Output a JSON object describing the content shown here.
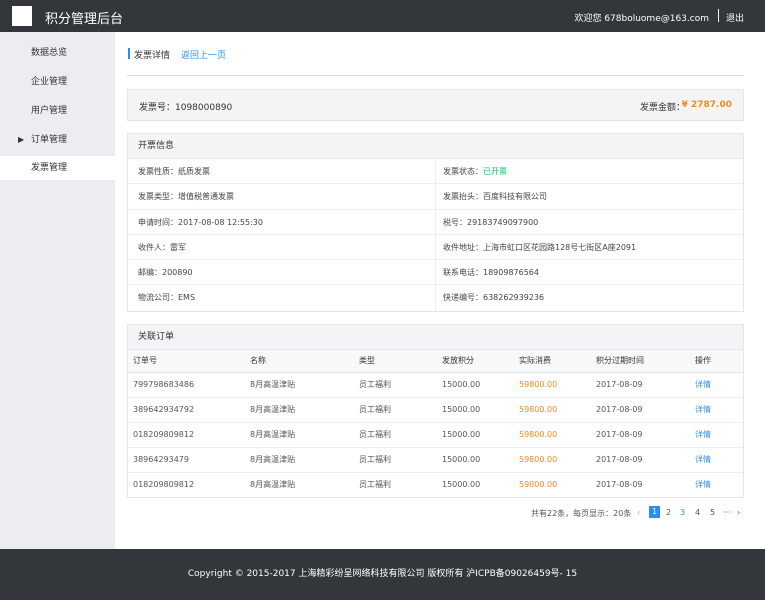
{
  "header": {
    "title": "积分管理后台",
    "welcome": "欢迎您 678boluome@163.com",
    "logout": "退出"
  },
  "sidebar": {
    "items": [
      {
        "label": "数据总览"
      },
      {
        "label": "企业管理"
      },
      {
        "label": "用户管理"
      },
      {
        "label": "订单管理"
      },
      {
        "label": "发票管理"
      }
    ]
  },
  "breadcrumb": {
    "title": "发票详情",
    "back": "返回上一页"
  },
  "invoice": {
    "number": "发票号：1098000890",
    "amount_label": "发票金额：",
    "amount": "¥ 2787.00"
  },
  "info_panel": {
    "title": "开票信息",
    "rows": [
      {
        "left": "发票性质：纸质发票",
        "right_label": "发票状态：",
        "right_value": "已开票"
      },
      {
        "left": "发票类型：增值税普通发票",
        "right_label": "发票抬头：百度科技有限公司",
        "right_value": ""
      },
      {
        "left": "申请时间：2017-08-08  12:55:30",
        "right_label": "税号：29183749097900",
        "right_value": ""
      },
      {
        "left": "收件人：雷军",
        "right_label": "收件地址：上海市虹口区花园路128号七街区A座2091",
        "right_value": ""
      },
      {
        "left": "邮编：200890",
        "right_label": "联系电话：18909876564",
        "right_value": ""
      },
      {
        "left": "物流公司：EMS",
        "right_label": "快递编号：638262939236",
        "right_value": ""
      }
    ]
  },
  "orders_panel": {
    "title": "关联订单",
    "columns": [
      "订单号",
      "名称",
      "类型",
      "发放积分",
      "实际消费",
      "积分过期时间",
      "操作"
    ],
    "rows": [
      [
        "799798683486",
        "8月高温津贴",
        "员工福利",
        "15000.00",
        "59800.00",
        "2017-08-09",
        "详情"
      ],
      [
        "389642934792",
        "8月高温津贴",
        "员工福利",
        "15000.00",
        "59800.00",
        "2017-08-09",
        "详情"
      ],
      [
        "018209809812",
        "8月高温津贴",
        "员工福利",
        "15000.00",
        "59800.00",
        "2017-08-09",
        "详情"
      ],
      [
        "38964293479",
        "8月高温津贴",
        "员工福利",
        "15000.00",
        "59800.00",
        "2017-08-09",
        "详情"
      ],
      [
        "018209809812",
        "8月高温津贴",
        "员工福利",
        "15000.00",
        "59800.00",
        "2017-08-09",
        "详情"
      ]
    ]
  },
  "pagination": {
    "summary": "共有22条，每页显示：20条",
    "prev": "‹",
    "pages": [
      "1",
      "2",
      "3",
      "4",
      "5"
    ],
    "ellipsis": "···",
    "next": "›",
    "current": "1"
  },
  "footer": {
    "text": "Copyright © 2015-2017 上海精彩纷呈网络科技有限公司 版权所有 沪ICPB备09026459号- 15"
  },
  "colors": {
    "accent": "#2d8cf0",
    "amount": "#f08a24",
    "status_ok": "#19be6b",
    "topbar": "#33363b"
  }
}
